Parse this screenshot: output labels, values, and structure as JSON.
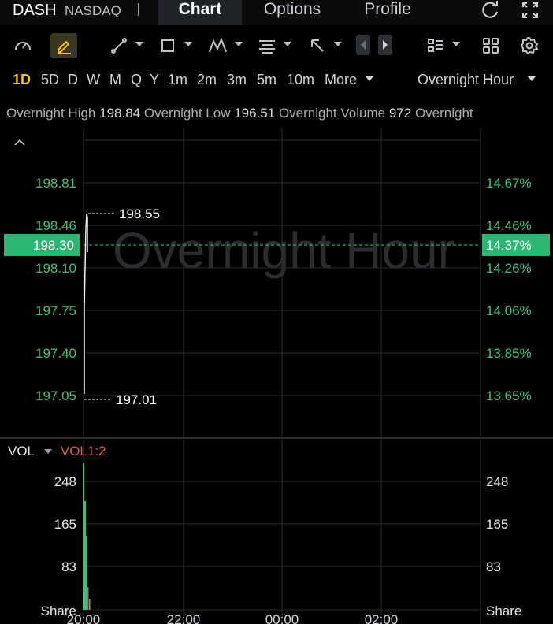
{
  "header": {
    "ticker": "DASH",
    "exchange": "NASDAQ",
    "tabs": [
      {
        "label": "Chart",
        "active": true
      },
      {
        "label": "Options",
        "active": false
      },
      {
        "label": "Profile",
        "active": false
      }
    ]
  },
  "periods": {
    "items": [
      "1D",
      "5D",
      "D",
      "W",
      "M",
      "Q",
      "Y",
      "1m",
      "2m",
      "3m",
      "5m",
      "10m"
    ],
    "active": "1D",
    "more_label": "More",
    "session_label": "Overnight Hour"
  },
  "info": {
    "high_label": "Overnight High",
    "high_value": "198.84",
    "low_label": "Overnight Low",
    "low_value": "196.51",
    "volume_label": "Overnight Volume",
    "volume_value": "972",
    "trailing": "Overnight"
  },
  "price_chart": {
    "watermark": "Overnight Hour",
    "left_ticks": [
      "198.81",
      "198.46",
      "198.10",
      "197.75",
      "197.40",
      "197.05"
    ],
    "right_ticks": [
      "14.67%",
      "14.46%",
      "14.26%",
      "14.06%",
      "13.85%",
      "13.65%"
    ],
    "current_price": "198.30",
    "current_pct": "14.37%",
    "high_marker": "198.55",
    "low_marker": "197.01"
  },
  "volume_chart": {
    "label": "VOL",
    "indicator": "VOL1:2",
    "left_ticks": [
      "248",
      "165",
      "83",
      "Share"
    ],
    "right_ticks": [
      "248",
      "165",
      "83",
      "Share"
    ],
    "time_labels": [
      "20:00",
      "22:00",
      "00:00",
      "02:00"
    ]
  },
  "colors": {
    "up": "#3ec27a",
    "down": "#e25a4a",
    "accent": "#f5c518",
    "grid": "#2a2d31"
  }
}
